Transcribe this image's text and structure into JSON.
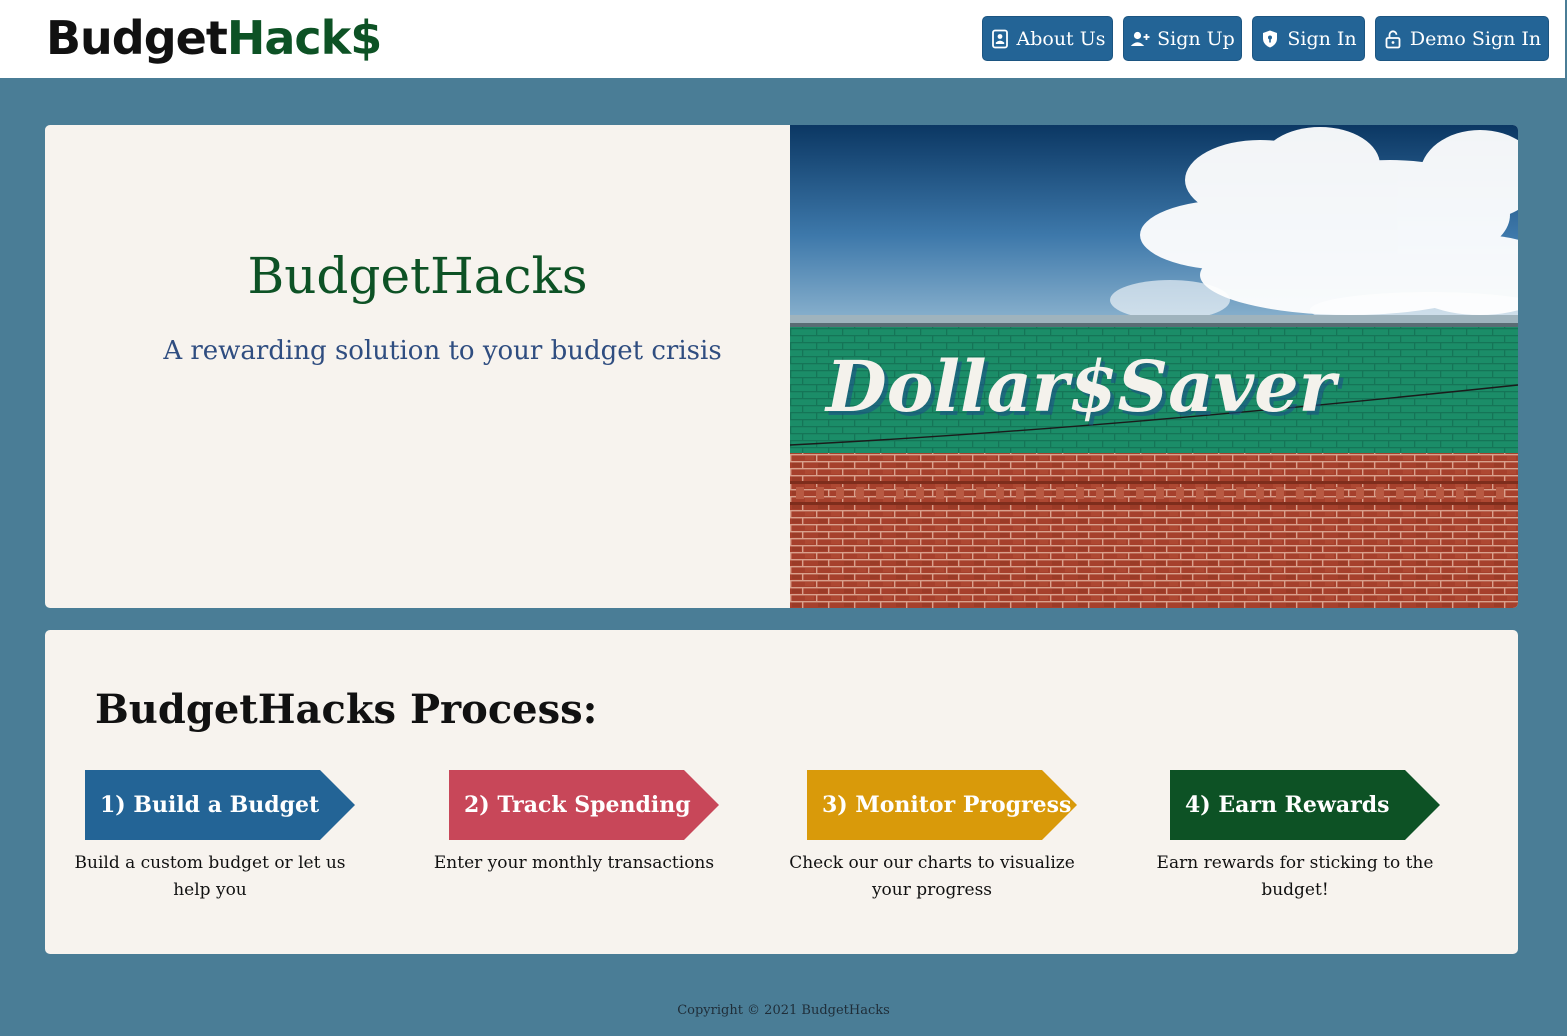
{
  "header": {
    "logo": {
      "part1": "Budget",
      "part2": "Hack$"
    },
    "nav": [
      {
        "label": "About Us",
        "icon": "person-badge-icon"
      },
      {
        "label": "Sign Up",
        "icon": "person-plus-icon"
      },
      {
        "label": "Sign In",
        "icon": "shield-icon"
      },
      {
        "label": "Demo Sign In",
        "icon": "unlock-icon"
      }
    ]
  },
  "hero": {
    "title": "BudgetHacks",
    "subtitle": "A rewarding solution to your budget crisis",
    "image": {
      "sign_text": "Dollar$Saver"
    }
  },
  "process": {
    "title": "BudgetHacks Process:",
    "steps": [
      {
        "label": "1) Build a Budget",
        "description": "Build a custom budget or let us help you",
        "color": "#236496"
      },
      {
        "label": "2) Track Spending",
        "description": "Enter your monthly transactions",
        "color": "#c84759"
      },
      {
        "label": "3) Monitor Progress",
        "description": "Check our our charts to visualize your progress",
        "color": "#d99a0a"
      },
      {
        "label": "4) Earn Rewards",
        "description": "Earn rewards for sticking to the budget!",
        "color": "#0d5225"
      }
    ]
  },
  "footer": {
    "copyright": "Copyright © 2021 BudgetHacks"
  },
  "colors": {
    "page_bg": "#4a7d96",
    "nav_button": "#236496",
    "brand_green": "#0d5225",
    "card_bg": "#f7f3ee",
    "subtitle_blue": "#2f4d80"
  }
}
